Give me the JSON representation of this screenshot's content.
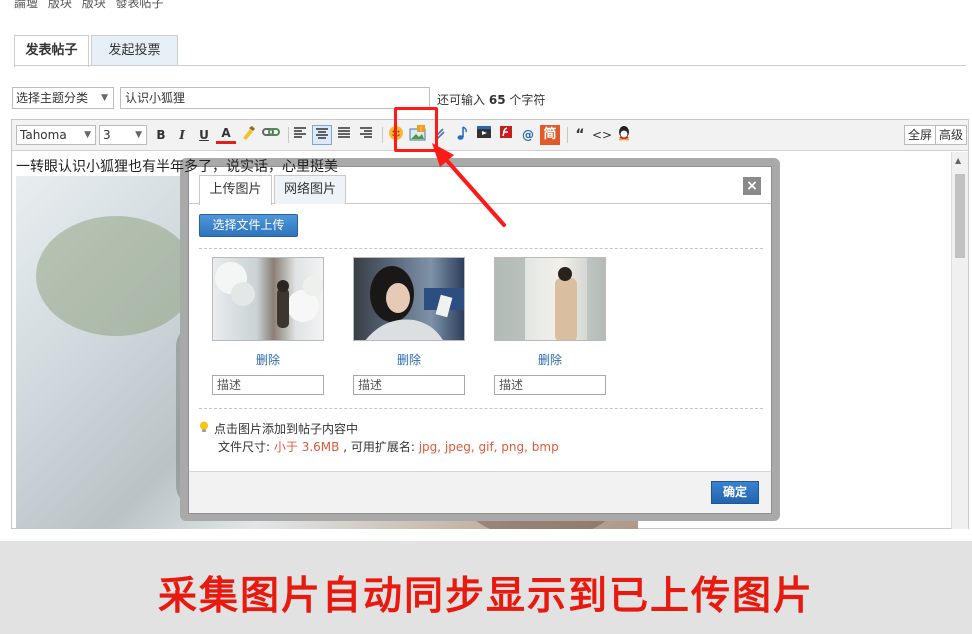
{
  "breadcrumb": [
    "論壇",
    "版块",
    "版块",
    "發表帖子"
  ],
  "tabs": [
    {
      "label": "发表帖子",
      "active": true
    },
    {
      "label": "发起投票",
      "active": false
    }
  ],
  "subject": {
    "category": "选择主题分类",
    "title": "认识小狐狸",
    "remaining_prefix": "还可输入",
    "remaining_count": "65",
    "remaining_suffix": "个字符"
  },
  "toolbar": {
    "font": "Tahoma",
    "size": "3",
    "bold": "B",
    "italic": "I",
    "underline": "U",
    "font_color": "A",
    "quote": "“",
    "code": "<>",
    "jian": "简",
    "at": "@",
    "fullscreen": "全屏",
    "advanced": "高级"
  },
  "editor": {
    "first_line": "一转眼认识小狐狸也有半年多了，说实话，心里挺美"
  },
  "dialog": {
    "tabs": [
      {
        "label": "上传图片",
        "active": true
      },
      {
        "label": "网络图片",
        "active": false
      }
    ],
    "close": "×",
    "upload_button": "选择文件上传",
    "thumbnails": [
      {
        "delete": "删除",
        "desc_placeholder": "描述"
      },
      {
        "delete": "删除",
        "desc_placeholder": "描述"
      },
      {
        "delete": "删除",
        "desc_placeholder": "描述"
      }
    ],
    "hint_line1": "点击图片添加到帖子内容中",
    "hint_size_label": "文件尺寸:",
    "hint_size_value": "小于 3.6MB",
    "hint_ext_label": ", 可用扩展名:",
    "hint_ext_value": "jpg, jpeg, gif, png, bmp",
    "ok": "确定"
  },
  "banner": {
    "text": "采集图片自动同步显示到已上传图片"
  },
  "colors": {
    "accent_red": "#e8190f",
    "link_blue": "#2a6ab3",
    "button_blue": "#2f73bb"
  }
}
